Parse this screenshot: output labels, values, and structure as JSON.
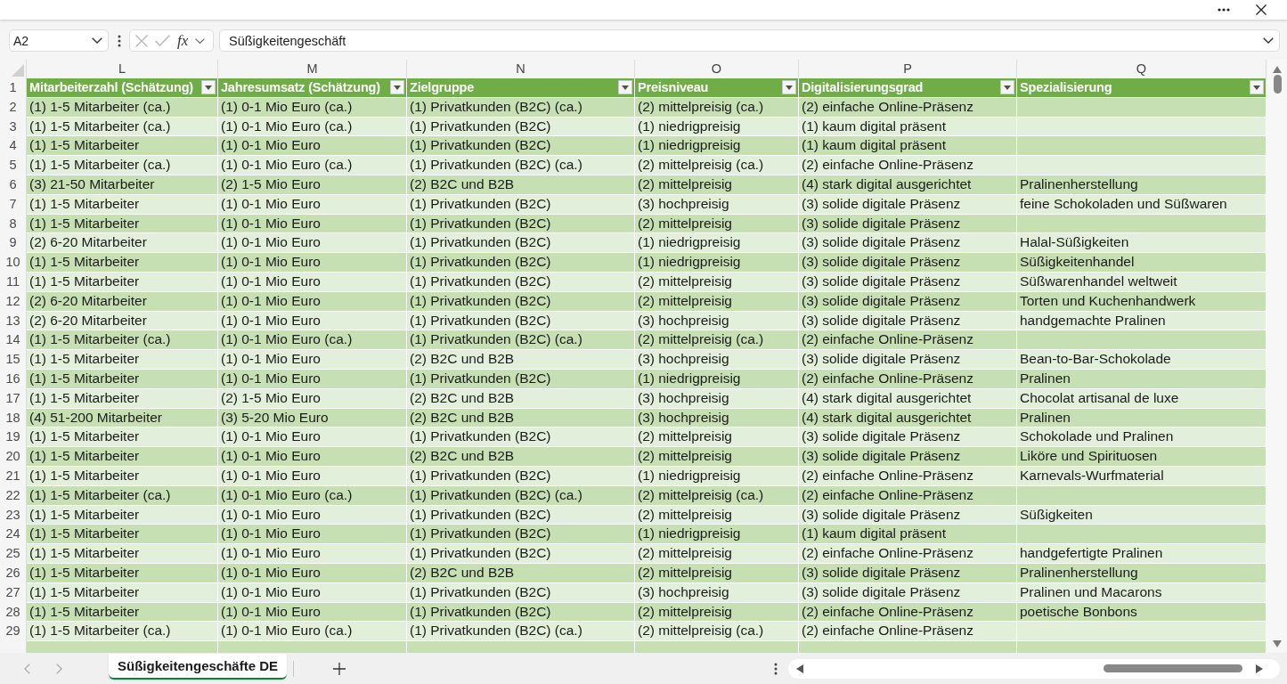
{
  "formula_bar": {
    "name_box": "A2",
    "function_label": "fx",
    "formula": "Süßigkeitengeschäft"
  },
  "sheet": {
    "columns": [
      {
        "letter": "L",
        "header": "Mitarbeiterzahl (Schätzung)"
      },
      {
        "letter": "M",
        "header": "Jahresumsatz (Schätzung)"
      },
      {
        "letter": "N",
        "header": "Zielgruppe"
      },
      {
        "letter": "O",
        "header": "Preisniveau"
      },
      {
        "letter": "P",
        "header": "Digitalisierungsgrad"
      },
      {
        "letter": "Q",
        "header": "Spezialisierung"
      }
    ],
    "header_row_number": "1",
    "rows": [
      {
        "number": "2",
        "cells": [
          "(1) 1-5 Mitarbeiter (ca.)",
          "(1) 0-1 Mio Euro (ca.)",
          "(1) Privatkunden (B2C) (ca.)",
          "(2) mittelpreisig (ca.)",
          "(2) einfache Online-Präsenz"
        ]
      },
      {
        "number": "3",
        "cells": [
          "(1) 1-5 Mitarbeiter (ca.)",
          "(1) 0-1 Mio Euro (ca.)",
          "(1) Privatkunden (B2C)",
          "(1) niedrigpreisig",
          "(1) kaum digital präsent"
        ]
      },
      {
        "number": "4",
        "cells": [
          "(1) 1-5 Mitarbeiter",
          "(1) 0-1 Mio Euro",
          "(1) Privatkunden (B2C)",
          "(1) niedrigpreisig",
          "(1) kaum digital präsent"
        ]
      },
      {
        "number": "5",
        "cells": [
          "(1) 1-5 Mitarbeiter (ca.)",
          "(1) 0-1 Mio Euro (ca.)",
          "(1) Privatkunden (B2C) (ca.)",
          "(2) mittelpreisig (ca.)",
          "(2) einfache Online-Präsenz"
        ]
      },
      {
        "number": "6",
        "cells": [
          "(3) 21-50 Mitarbeiter",
          "(2) 1-5 Mio Euro",
          "(2) B2C und B2B",
          "(2) mittelpreisig",
          "(4) stark digital ausgerichtet",
          "Pralinenherstellung"
        ]
      },
      {
        "number": "7",
        "cells": [
          "(1) 1-5 Mitarbeiter",
          "(1) 0-1 Mio Euro",
          "(1) Privatkunden (B2C)",
          "(3) hochpreisig",
          "(3) solide digitale Präsenz",
          "feine Schokoladen und Süßwaren"
        ]
      },
      {
        "number": "8",
        "cells": [
          "(1) 1-5 Mitarbeiter",
          "(1) 0-1 Mio Euro",
          "(1) Privatkunden (B2C)",
          "(2) mittelpreisig",
          "(3) solide digitale Präsenz"
        ]
      },
      {
        "number": "9",
        "cells": [
          "(2) 6-20 Mitarbeiter",
          "(1) 0-1 Mio Euro",
          "(1) Privatkunden (B2C)",
          "(1) niedrigpreisig",
          "(3) solide digitale Präsenz",
          "Halal-Süßigkeiten"
        ]
      },
      {
        "number": "10",
        "cells": [
          "(1) 1-5 Mitarbeiter",
          "(1) 0-1 Mio Euro",
          "(1) Privatkunden (B2C)",
          "(1) niedrigpreisig",
          "(3) solide digitale Präsenz",
          "Süßigkeitenhandel"
        ]
      },
      {
        "number": "11",
        "cells": [
          "(1) 1-5 Mitarbeiter",
          "(1) 0-1 Mio Euro",
          "(1) Privatkunden (B2C)",
          "(2) mittelpreisig",
          "(3) solide digitale Präsenz",
          "Süßwarenhandel weltweit"
        ]
      },
      {
        "number": "12",
        "cells": [
          "(2) 6-20 Mitarbeiter",
          "(1) 0-1 Mio Euro",
          "(1) Privatkunden (B2C)",
          "(2) mittelpreisig",
          "(3) solide digitale Präsenz",
          "Torten und Kuchenhandwerk"
        ]
      },
      {
        "number": "13",
        "cells": [
          "(2) 6-20 Mitarbeiter",
          "(1) 0-1 Mio Euro",
          "(1) Privatkunden (B2C)",
          "(3) hochpreisig",
          "(3) solide digitale Präsenz",
          "handgemachte Pralinen"
        ]
      },
      {
        "number": "14",
        "cells": [
          "(1) 1-5 Mitarbeiter (ca.)",
          "(1) 0-1 Mio Euro (ca.)",
          "(1) Privatkunden (B2C) (ca.)",
          "(2) mittelpreisig (ca.)",
          "(2) einfache Online-Präsenz"
        ]
      },
      {
        "number": "15",
        "cells": [
          "(1) 1-5 Mitarbeiter",
          "(1) 0-1 Mio Euro",
          "(2) B2C und B2B",
          "(3) hochpreisig",
          "(3) solide digitale Präsenz",
          "Bean-to-Bar-Schokolade"
        ]
      },
      {
        "number": "16",
        "cells": [
          "(1) 1-5 Mitarbeiter",
          "(1) 0-1 Mio Euro",
          "(1) Privatkunden (B2C)",
          "(1) niedrigpreisig",
          "(2) einfache Online-Präsenz",
          "Pralinen"
        ]
      },
      {
        "number": "17",
        "cells": [
          "(1) 1-5 Mitarbeiter",
          "(2) 1-5 Mio Euro",
          "(2) B2C und B2B",
          "(3) hochpreisig",
          "(4) stark digital ausgerichtet",
          "Chocolat artisanal de luxe"
        ]
      },
      {
        "number": "18",
        "cells": [
          "(4) 51-200 Mitarbeiter",
          "(3) 5-20 Mio Euro",
          "(2) B2C und B2B",
          "(3) hochpreisig",
          "(4) stark digital ausgerichtet",
          "Pralinen"
        ]
      },
      {
        "number": "19",
        "cells": [
          "(1) 1-5 Mitarbeiter",
          "(1) 0-1 Mio Euro",
          "(1) Privatkunden (B2C)",
          "(2) mittelpreisig",
          "(3) solide digitale Präsenz",
          "Schokolade und Pralinen"
        ]
      },
      {
        "number": "20",
        "cells": [
          "(1) 1-5 Mitarbeiter",
          "(1) 0-1 Mio Euro",
          "(2) B2C und B2B",
          "(2) mittelpreisig",
          "(3) solide digitale Präsenz",
          "Liköre und Spirituosen"
        ]
      },
      {
        "number": "21",
        "cells": [
          "(1) 1-5 Mitarbeiter",
          "(1) 0-1 Mio Euro",
          "(1) Privatkunden (B2C)",
          "(1) niedrigpreisig",
          "(2) einfache Online-Präsenz",
          "Karnevals-Wurfmaterial"
        ]
      },
      {
        "number": "22",
        "cells": [
          "(1) 1-5 Mitarbeiter (ca.)",
          "(1) 0-1 Mio Euro (ca.)",
          "(1) Privatkunden (B2C) (ca.)",
          "(2) mittelpreisig (ca.)",
          "(2) einfache Online-Präsenz"
        ]
      },
      {
        "number": "23",
        "cells": [
          "(1) 1-5 Mitarbeiter",
          "(1) 0-1 Mio Euro",
          "(1) Privatkunden (B2C)",
          "(2) mittelpreisig",
          "(3) solide digitale Präsenz",
          "Süßigkeiten"
        ]
      },
      {
        "number": "24",
        "cells": [
          "(1) 1-5 Mitarbeiter",
          "(1) 0-1 Mio Euro",
          "(1) Privatkunden (B2C)",
          "(1) niedrigpreisig",
          "(1) kaum digital präsent"
        ]
      },
      {
        "number": "25",
        "cells": [
          "(1) 1-5 Mitarbeiter",
          "(1) 0-1 Mio Euro",
          "(1) Privatkunden (B2C)",
          "(2) mittelpreisig",
          "(2) einfache Online-Präsenz",
          "handgefertigte Pralinen"
        ]
      },
      {
        "number": "26",
        "cells": [
          "(1) 1-5 Mitarbeiter",
          "(1) 0-1 Mio Euro",
          "(2) B2C und B2B",
          "(2) mittelpreisig",
          "(3) solide digitale Präsenz",
          "Pralinenherstellung"
        ]
      },
      {
        "number": "27",
        "cells": [
          "(1) 1-5 Mitarbeiter",
          "(1) 0-1 Mio Euro",
          "(1) Privatkunden (B2C)",
          "(3) hochpreisig",
          "(3) solide digitale Präsenz",
          "Pralinen und Macarons"
        ]
      },
      {
        "number": "28",
        "cells": [
          "(1) 1-5 Mitarbeiter",
          "(1) 0-1 Mio Euro",
          "(1) Privatkunden (B2C)",
          "(2) mittelpreisig",
          "(2) einfache Online-Präsenz",
          "poetische Bonbons"
        ]
      },
      {
        "number": "29",
        "cells": [
          "(1) 1-5 Mitarbeiter (ca.)",
          "(1) 0-1 Mio Euro (ca.)",
          "(1) Privatkunden (B2C) (ca.)",
          "(2) mittelpreisig (ca.)",
          "(2) einfache Online-Präsenz"
        ]
      }
    ]
  },
  "sheet_tabs": [
    {
      "label": "Süßigkeitengeschäfte DE",
      "selected": true
    }
  ]
}
